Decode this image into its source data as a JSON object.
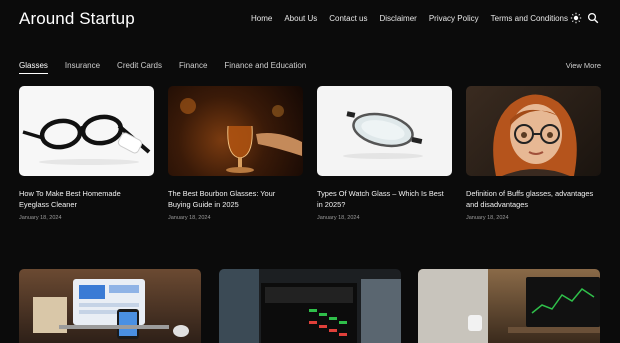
{
  "brand": "Around Startup",
  "nav": [
    "Home",
    "About Us",
    "Contact us",
    "Disclaimer",
    "Privacy Policy",
    "Terms and Conditions"
  ],
  "icons": {
    "theme": "sun-icon",
    "search": "search-icon"
  },
  "tabs": [
    "Glasses",
    "Insurance",
    "Credit Cards",
    "Finance",
    "Finance and Education"
  ],
  "view_more": "View More",
  "posts": [
    {
      "title": "How To Make Best Homemade Eyeglass Cleaner",
      "date": "January 18, 2024"
    },
    {
      "title": "The Best Bourbon Glasses: Your Buying Guide in 2025",
      "date": "January 18, 2024"
    },
    {
      "title": "Types Of Watch Glass – Which Is Best in 2025?",
      "date": "January 18, 2024"
    },
    {
      "title": "Definition of Buffs glasses, advantages and disadvantages",
      "date": "January 18, 2024"
    }
  ]
}
